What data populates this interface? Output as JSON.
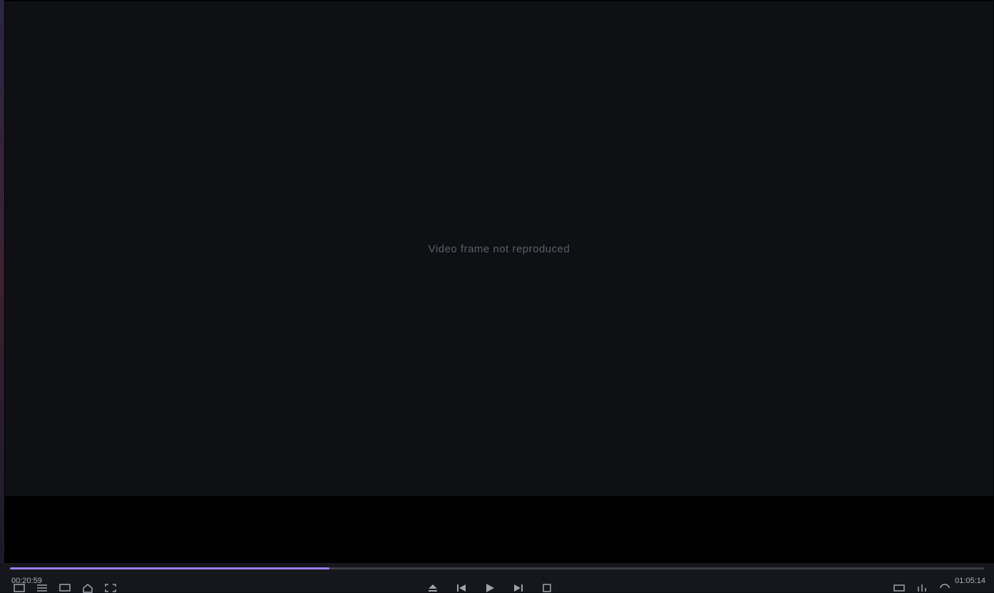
{
  "player": {
    "current_time": "00:20:59",
    "total_time": "01:05:14",
    "progress": 0.328,
    "video_placeholder": "Video frame not reproduced",
    "accent_color": "#9b7cf0"
  },
  "icons": {
    "left": [
      "subtitle-icon",
      "playlist-icon",
      "screen-icon",
      "home-icon",
      "fullscreen-icon"
    ],
    "center": [
      "eject-icon",
      "previous-icon",
      "play-icon",
      "next-icon",
      "stop-icon"
    ],
    "right": [
      "settings-icon",
      "equalizer-icon",
      "repeat-icon"
    ]
  }
}
